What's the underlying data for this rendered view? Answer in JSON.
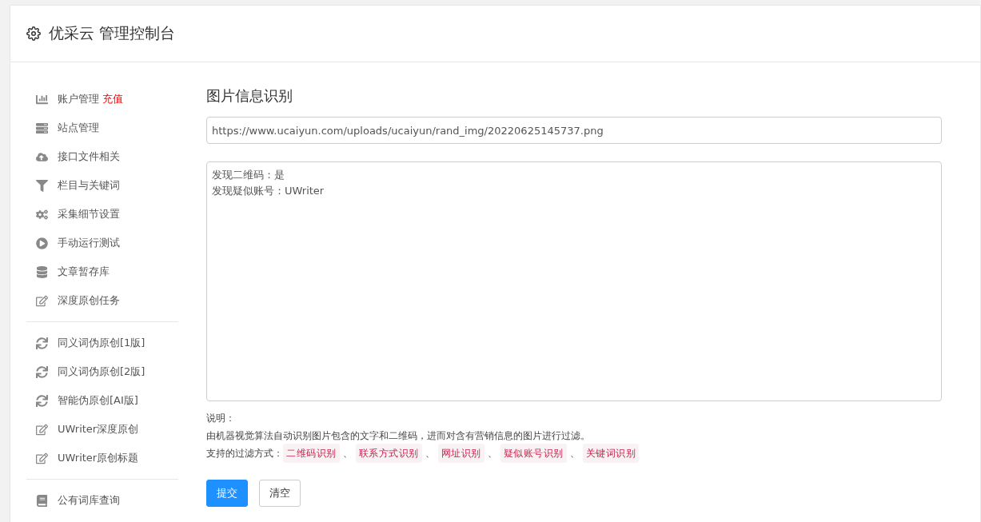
{
  "header": {
    "title": "优采云 管理控制台"
  },
  "sidebar": {
    "groups": [
      {
        "items": [
          {
            "label": "账户管理",
            "badge": "充值"
          },
          {
            "label": "站点管理"
          },
          {
            "label": "接口文件相关"
          },
          {
            "label": "栏目与关键词"
          },
          {
            "label": "采集细节设置"
          },
          {
            "label": "手动运行测试"
          },
          {
            "label": "文章暂存库"
          },
          {
            "label": "深度原创任务"
          }
        ]
      },
      {
        "items": [
          {
            "label": "同义词伪原创[1版]"
          },
          {
            "label": "同义词伪原创[2版]"
          },
          {
            "label": "智能伪原创[AI版]"
          },
          {
            "label": "UWriter深度原创"
          },
          {
            "label": "UWriter原创标题"
          }
        ]
      },
      {
        "items": [
          {
            "label": "公有词库查询"
          }
        ]
      }
    ]
  },
  "main": {
    "title": "图片信息识别",
    "url_field": {
      "value": "https://www.ucaiyun.com/uploads/ucaiyun/rand_img/20220625145737.png"
    },
    "result_lines": [
      "发现二维码：是",
      "发现疑似账号：UWriter"
    ],
    "notes_label": "说明：",
    "description": "由机器视觉算法自动识别图片包含的文字和二维码，进而对含有营销信息的图片进行过滤。",
    "filters_label": "支持的过滤方式：",
    "filters": [
      "二维码识别",
      "联系方式识别",
      "网址识别",
      "疑似账号识别",
      "关键词识别"
    ],
    "separator": "、",
    "buttons": [
      {
        "label": "提交",
        "kind": "primary"
      },
      {
        "label": "清空",
        "kind": "default"
      }
    ]
  }
}
